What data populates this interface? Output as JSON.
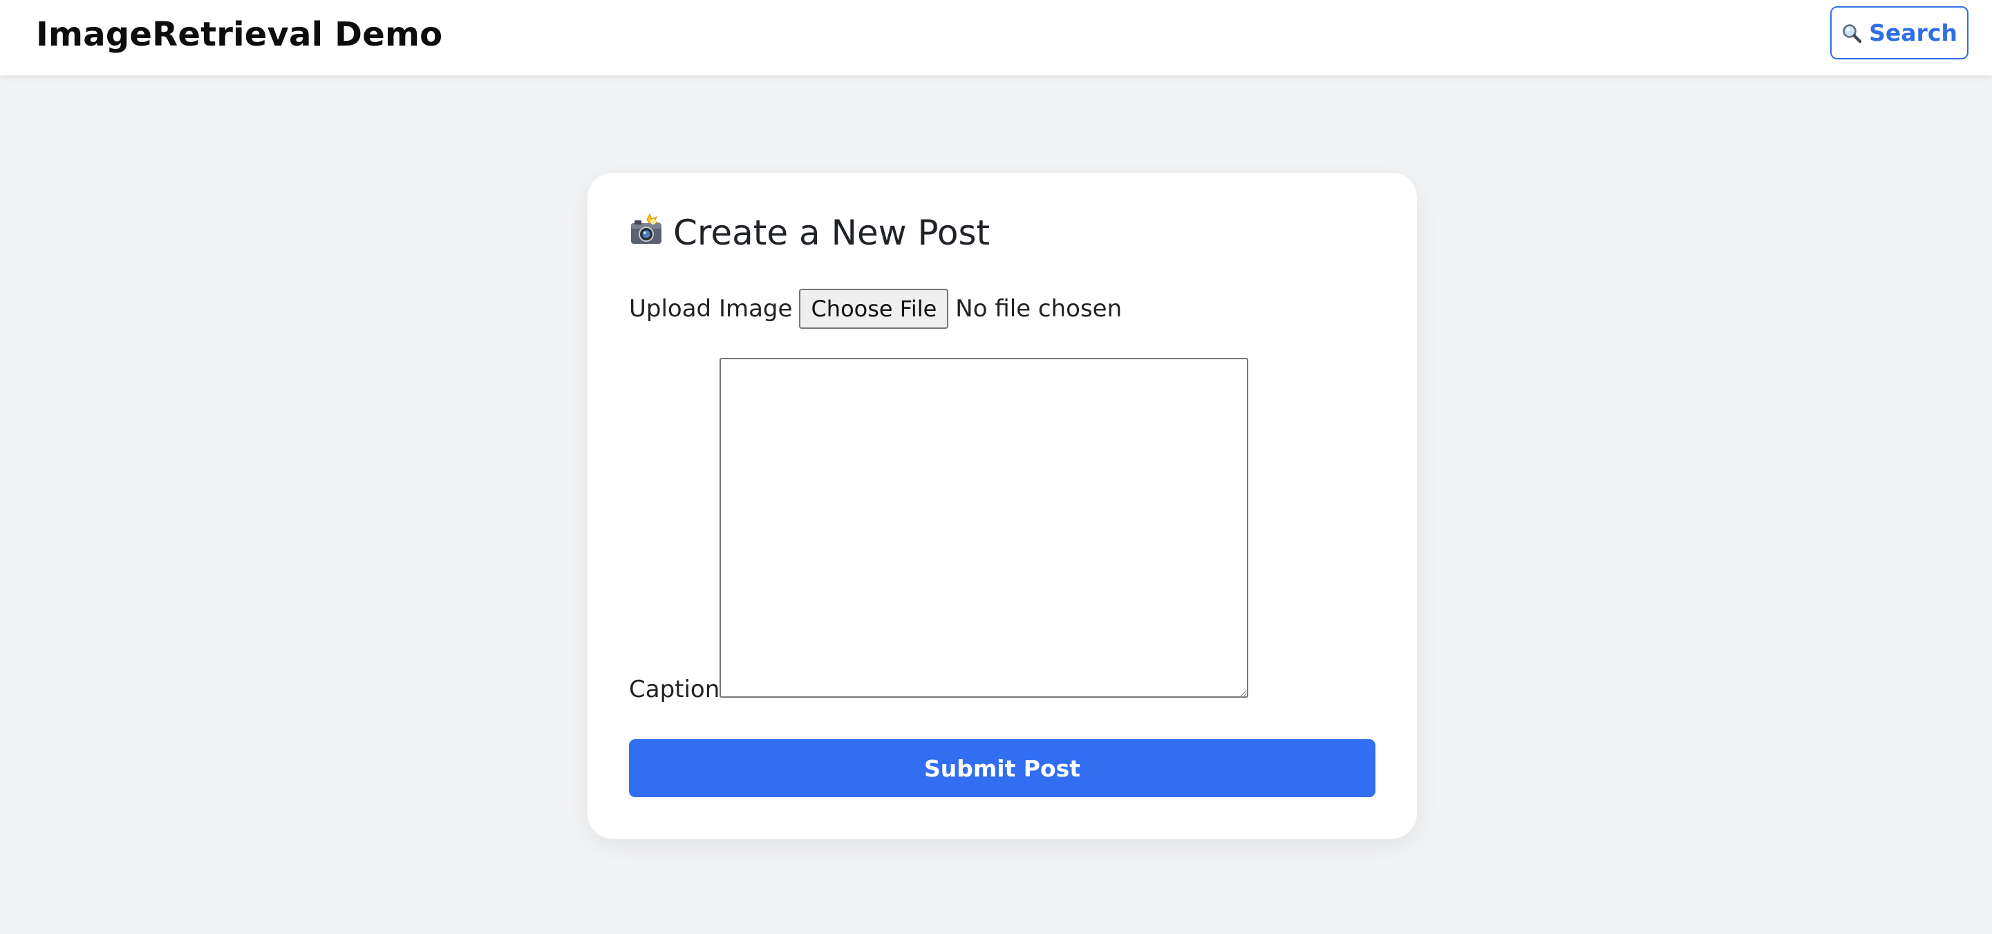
{
  "app": {
    "title": "ImageRetrieval Demo"
  },
  "header": {
    "search_button": {
      "icon": "magnifier-icon",
      "label": "Search"
    }
  },
  "form": {
    "title_icon": "camera-flash-icon",
    "title": "Create a New Post",
    "upload": {
      "label": "Upload Image",
      "button_label": "Choose File",
      "status": "No file chosen"
    },
    "caption": {
      "label": "Caption",
      "value": ""
    },
    "submit_label": "Submit Post"
  },
  "colors": {
    "accent": "#326ef2",
    "link_blue": "#2f6fe4",
    "page_background": "#f2f3f5",
    "card_background": "#ffffff"
  }
}
